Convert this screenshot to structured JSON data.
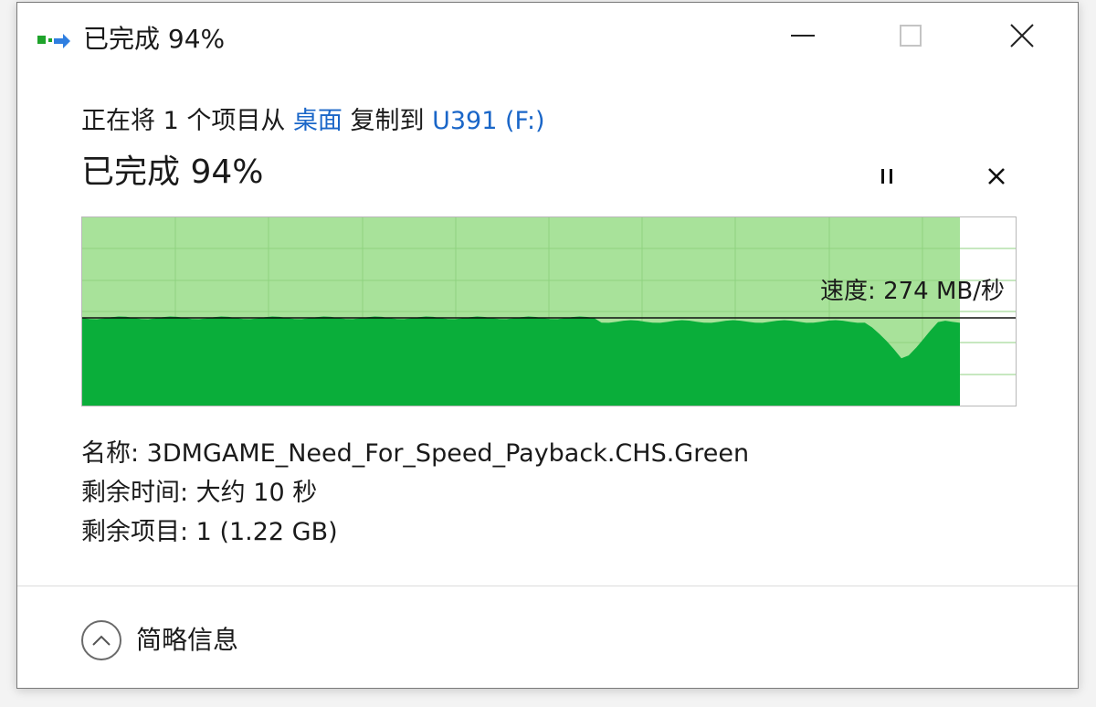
{
  "window": {
    "title": "已完成 94%",
    "icons": {
      "app": "copy-transfer-icon",
      "minimize": "minimize-icon",
      "maximize": "maximize-icon",
      "close": "close-icon"
    }
  },
  "operation": {
    "prefix": "正在将 1 个项目从 ",
    "source": "桌面",
    "middle": " 复制到 ",
    "destination": "U391 (F:)"
  },
  "progress": {
    "title": "已完成 94%",
    "percent": 94,
    "pause_icon": "pause-icon",
    "cancel_icon": "cancel-icon"
  },
  "graph": {
    "speed_label": "速度: 274 MB/秒",
    "colors": {
      "done_fill": "#a8e29a",
      "speed_fill": "#0aae3a",
      "grid": "#8fd280",
      "speed_line": "#111111"
    }
  },
  "details": {
    "name_line": "名称: 3DMGAME_Need_For_Speed_Payback.CHS.Green",
    "time_line": "剩余时间: 大约 10 秒",
    "items_line": "剩余项目: 1 (1.22 GB)"
  },
  "footer": {
    "toggle_label": "简略信息",
    "toggle_icon": "chevron-up-icon"
  }
}
